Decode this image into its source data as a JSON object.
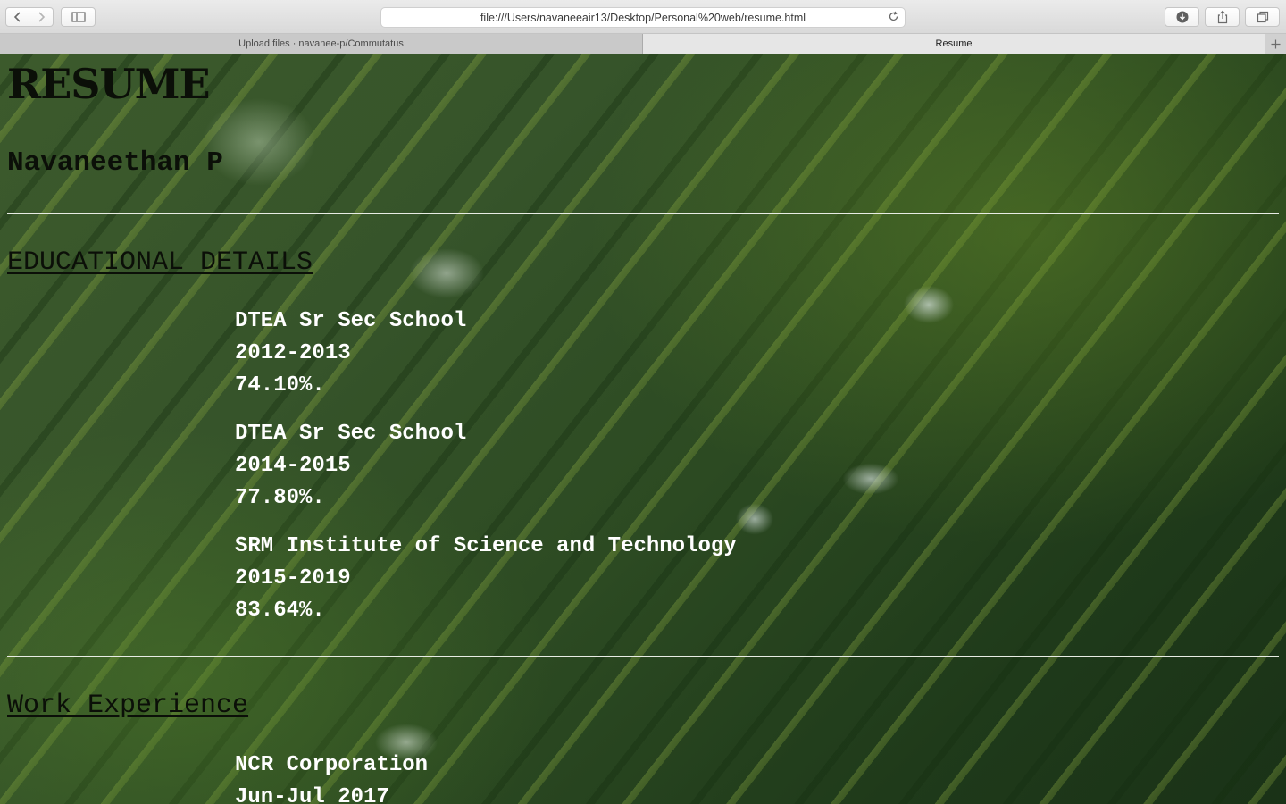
{
  "browser": {
    "url": "file:///Users/navaneeair13/Desktop/Personal%20web/resume.html",
    "tabs": [
      {
        "label": "Upload files · navanee-p/Commutatus",
        "active": false
      },
      {
        "label": "Resume",
        "active": true
      }
    ],
    "icons": {
      "back": "chevron-left-icon",
      "forward": "chevron-right-icon",
      "sidebar": "sidebar-icon",
      "reload": "reload-icon",
      "downloads": "download-icon",
      "share": "share-icon",
      "tabs_overview": "tabs-overview-icon",
      "new_tab": "plus-icon"
    }
  },
  "page": {
    "title": "RESUME",
    "name": "Navaneethan P",
    "education": {
      "heading": "EDUCATIONAL DETAILS",
      "entries": [
        {
          "school": "DTEA Sr Sec School",
          "years": "2012-2013",
          "score": "74.10%."
        },
        {
          "school": "DTEA Sr Sec School",
          "years": "2014-2015",
          "score": "77.80%."
        },
        {
          "school": "SRM Institute of Science and Technology",
          "years": "2015-2019",
          "score": "83.64%."
        }
      ]
    },
    "work": {
      "heading": "Work Experience",
      "entries": [
        {
          "company": "NCR Corporation",
          "period": "Jun-Jul 2017"
        }
      ]
    }
  }
}
